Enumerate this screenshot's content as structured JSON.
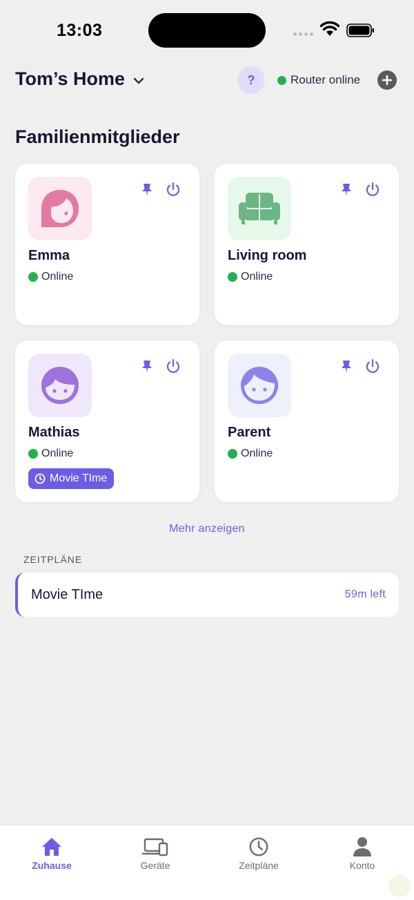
{
  "status_bar": {
    "time": "13:03"
  },
  "header": {
    "title": "Tom’s Home",
    "help_label": "?",
    "router_status": "Router online"
  },
  "section_title": "Familienmitglieder",
  "members": [
    {
      "name": "Emma",
      "status": "Online",
      "avatar_icon": "girl-face-icon",
      "avatar_bg": "#fde9f0",
      "avatar_color": "#e27aa2"
    },
    {
      "name": "Living room",
      "status": "Online",
      "avatar_icon": "sofa-icon",
      "avatar_bg": "#e6f8ea",
      "avatar_color": "#6cb585"
    },
    {
      "name": "Mathias",
      "status": "Online",
      "avatar_icon": "boy-face-icon",
      "avatar_bg": "#efe8fb",
      "avatar_color": "#9d73dc",
      "badge": "Movie TIme"
    },
    {
      "name": "Parent",
      "status": "Online",
      "avatar_icon": "adult-face-icon",
      "avatar_bg": "#eef1fc",
      "avatar_color": "#8c83ea"
    }
  ],
  "more_link": "Mehr anzeigen",
  "schedules": {
    "label": "ZEITPLÄNE",
    "items": [
      {
        "name": "Movie TIme",
        "remaining": "59m left"
      }
    ]
  },
  "tabs": [
    {
      "label": "Zuhause",
      "icon": "home-icon",
      "active": true
    },
    {
      "label": "Geräte",
      "icon": "devices-icon",
      "active": false
    },
    {
      "label": "Zeitpläne",
      "icon": "clock-icon",
      "active": false
    },
    {
      "label": "Konto",
      "icon": "person-icon",
      "active": false
    }
  ],
  "colors": {
    "accent": "#6d5ce6",
    "online": "#25b04f",
    "background": "#efefef"
  }
}
